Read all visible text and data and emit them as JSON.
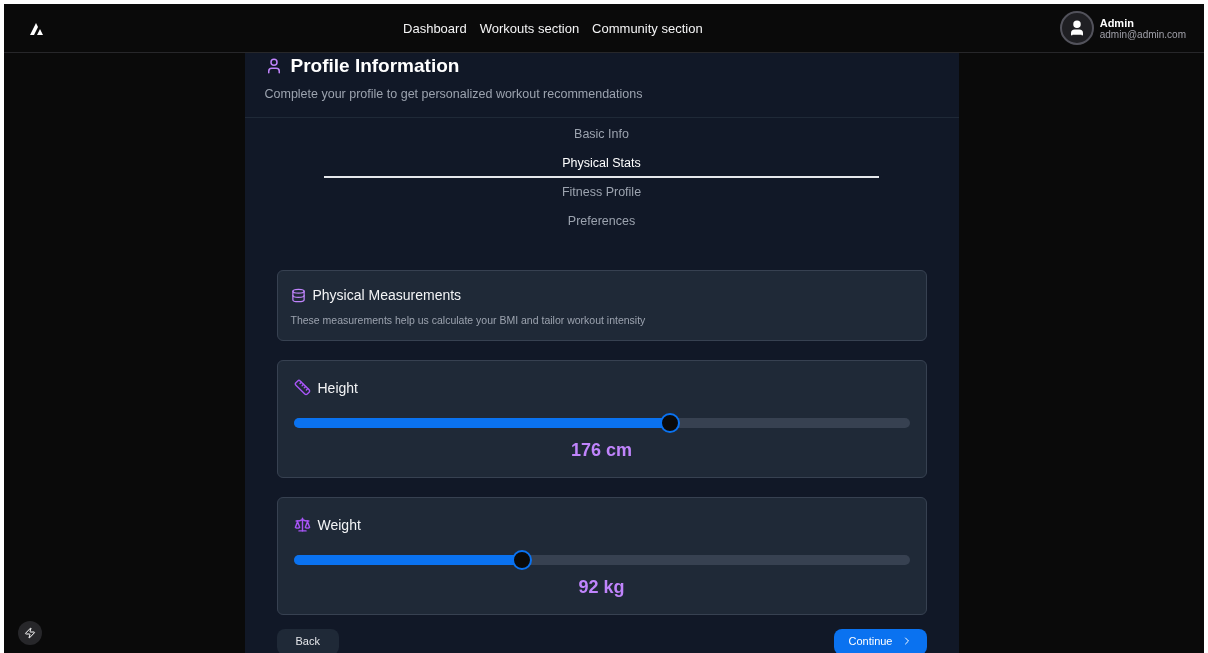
{
  "nav": {
    "links": [
      "Dashboard",
      "Workouts section",
      "Community section"
    ]
  },
  "user": {
    "name": "Admin",
    "email": "admin@admin.com"
  },
  "profile": {
    "title": "Profile Information",
    "subtitle": "Complete your profile to get personalized workout recommendations"
  },
  "tabs": [
    {
      "label": "Basic Info",
      "selected": false
    },
    {
      "label": "Physical Stats",
      "selected": true
    },
    {
      "label": "Fitness Profile",
      "selected": false
    },
    {
      "label": "Preferences",
      "selected": false
    }
  ],
  "section": {
    "title": "Physical Measurements",
    "description": "These measurements help us calculate your BMI and tailor workout intensity"
  },
  "sliders": [
    {
      "kind": "height",
      "label": "Height",
      "level": 0.61,
      "reading": "176 cm"
    },
    {
      "kind": "weight",
      "label": "Weight",
      "level": 0.37,
      "reading": "92 kg"
    }
  ],
  "buttons": {
    "back": "Back",
    "continue": "Continue"
  }
}
